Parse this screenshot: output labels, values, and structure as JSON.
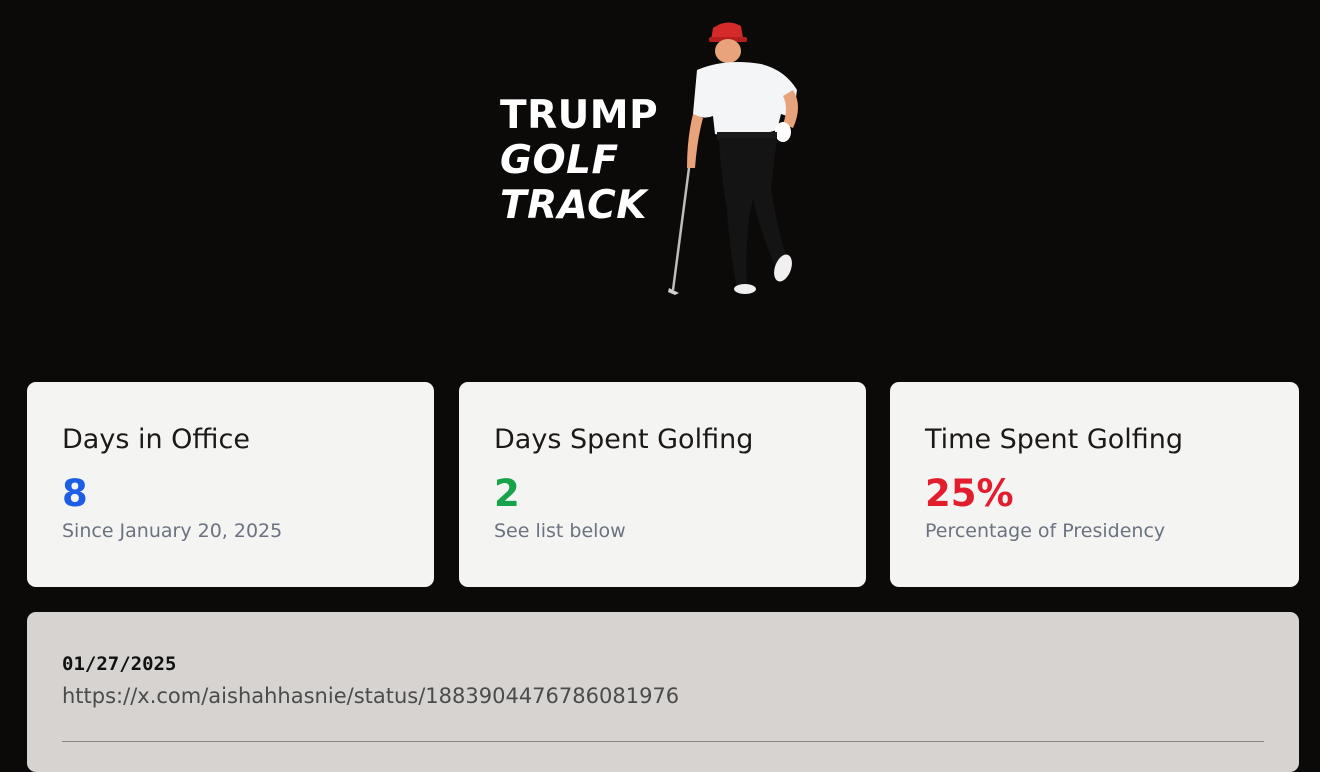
{
  "logo": {
    "line1": "TRUMP",
    "line2": "GOLF",
    "line3": "TRACK"
  },
  "colors": {
    "background": "#0c0a09",
    "days_value": "#1d5ee6",
    "golf_days_value": "#16a34a",
    "percent_value": "#e11d2e",
    "card_bg": "#f4f4f2",
    "log_bg": "#d7d3d0"
  },
  "stats": [
    {
      "title": "Days in Office",
      "value": "8",
      "subtitle": "Since January 20, 2025"
    },
    {
      "title": "Days Spent Golfing",
      "value": "2",
      "subtitle": "See list below"
    },
    {
      "title": "Time Spent Golfing",
      "value": "25%",
      "subtitle": "Percentage of Presidency"
    }
  ],
  "entries": [
    {
      "date": "01/27/2025",
      "link": "https://x.com/aishahhasnie/status/1883904476786081976"
    }
  ]
}
